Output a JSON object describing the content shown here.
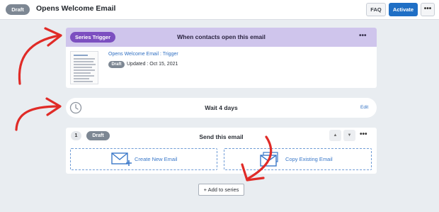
{
  "header": {
    "status": "Draft",
    "title": "Opens Welcome Email",
    "faq_label": "FAQ",
    "activate_label": "Activate",
    "more_label": "•••"
  },
  "trigger": {
    "badge": "Series Trigger",
    "title": "When contacts open this email",
    "more_label": "•••",
    "link": "Opens Welcome Email : Trigger",
    "status": "Draft",
    "updated": "Updated : Oct 15, 2021"
  },
  "wait": {
    "title": "Wait 4 days",
    "edit_label": "Edit"
  },
  "email_step": {
    "number": "1",
    "status": "Draft",
    "title": "Send this email",
    "up_label": "▲",
    "down_label": "▼",
    "more_label": "•••",
    "create_label": "Create New Email",
    "copy_label": "Copy Existing Email"
  },
  "add_button": {
    "label": "+ Add to series"
  },
  "colors": {
    "accent_blue": "#1f6fc5",
    "trigger_purple": "#7c4fc0",
    "trigger_header": "#cfc5ec",
    "annotation_red": "#e02b27"
  },
  "icons": [
    "clock-icon",
    "envelope-plus-icon",
    "envelope-copy-icon",
    "email-thumbnail",
    "annotation-arrow"
  ]
}
